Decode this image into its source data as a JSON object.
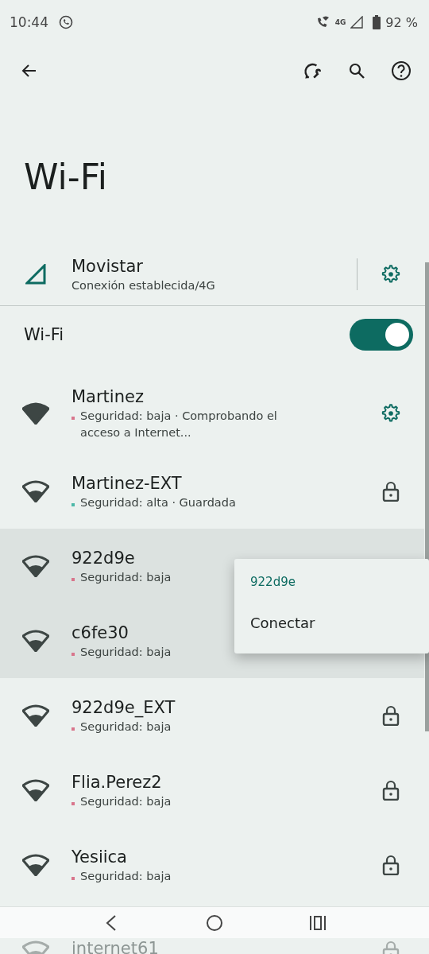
{
  "status_bar": {
    "time": "10:44",
    "network_type": "4G",
    "battery": "92 %"
  },
  "title": "Wi-Fi",
  "mobile": {
    "name": "Movistar",
    "detail": "Conexión establecida/4G"
  },
  "wifi_toggle": {
    "label": "Wi-Fi",
    "on": true
  },
  "networks": [
    {
      "name": "Martinez",
      "detail": "Seguridad: baja · Comprobando el acceso a Internet...",
      "color": "#d8758c",
      "kind": "settings",
      "connected": true,
      "selected": false
    },
    {
      "name": "Martinez-EXT",
      "detail": "Seguridad: alta · Guardada",
      "color": "#4cb8a8",
      "kind": "locked",
      "connected": false,
      "selected": false
    },
    {
      "name": "922d9e",
      "detail": "Seguridad: baja",
      "color": "#d8758c",
      "kind": "plain",
      "connected": false,
      "selected": true
    },
    {
      "name": "c6fe30",
      "detail": "Seguridad: baja",
      "color": "#d8758c",
      "kind": "plain",
      "connected": false,
      "selected": true
    },
    {
      "name": "922d9e_EXT",
      "detail": "Seguridad: baja",
      "color": "#d8758c",
      "kind": "locked",
      "connected": false,
      "selected": false
    },
    {
      "name": "Flia.Perez2",
      "detail": "Seguridad: baja",
      "color": "#d8758c",
      "kind": "locked",
      "connected": false,
      "selected": false
    },
    {
      "name": "Yesiica",
      "detail": "Seguridad: baja",
      "color": "#d8758c",
      "kind": "locked",
      "connected": false,
      "selected": false
    },
    {
      "name": "internet61",
      "kind": "locked",
      "connected": false,
      "selected": false
    }
  ],
  "context_menu": {
    "title": "922d9e",
    "items": [
      "Conectar"
    ]
  }
}
